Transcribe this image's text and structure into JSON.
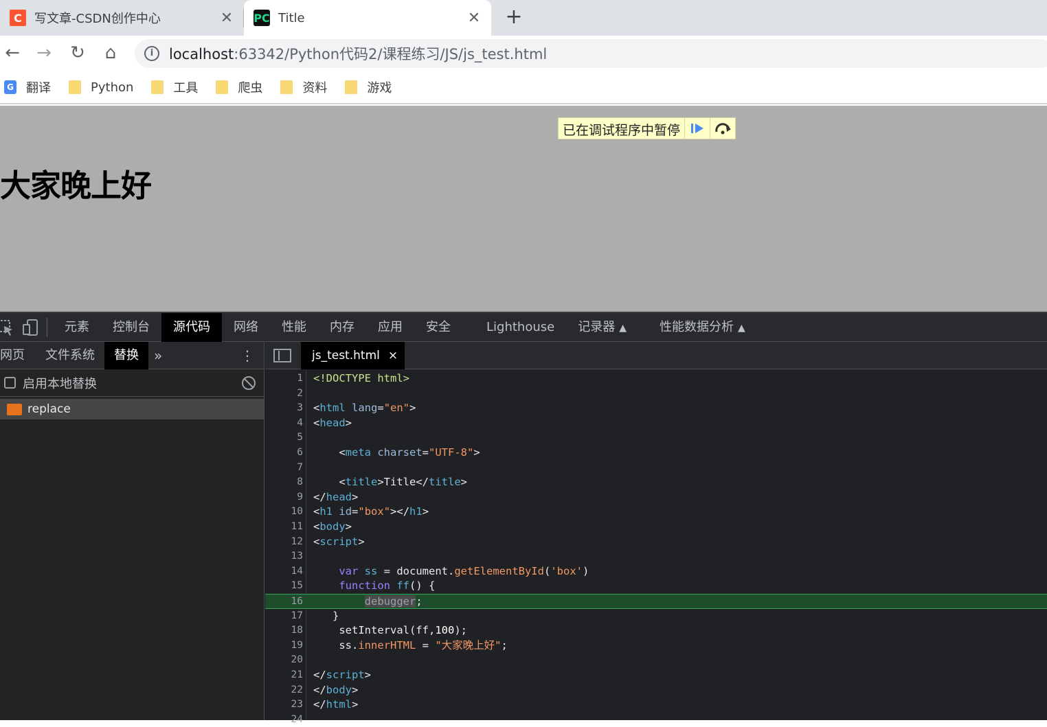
{
  "browser": {
    "tabs": [
      {
        "title": "写文章-CSDN创作中心",
        "favicon": "csdn-icon",
        "active": false
      },
      {
        "title": "Title",
        "favicon": "pycharm-icon",
        "active": true
      }
    ],
    "new_tab_symbol": "+",
    "url_host": "localhost",
    "url_rest": ":63342/Python代码2/课程练习/JS/js_test.html",
    "bookmarks": [
      {
        "label": "翻译",
        "icon": "translate-icon"
      },
      {
        "label": "Python",
        "icon": "folder-icon"
      },
      {
        "label": "工具",
        "icon": "folder-icon"
      },
      {
        "label": "爬虫",
        "icon": "folder-icon"
      },
      {
        "label": "资料",
        "icon": "folder-icon"
      },
      {
        "label": "游戏",
        "icon": "folder-icon"
      }
    ]
  },
  "page": {
    "heading": "大家晚上好",
    "paused_text": "已在调试程序中暂停"
  },
  "devtools": {
    "tabs": [
      "元素",
      "控制台",
      "源代码",
      "网络",
      "性能",
      "内存",
      "应用",
      "安全",
      "Lighthouse",
      "记录器",
      "性能数据分析"
    ],
    "active_tab": "源代码",
    "navigator": {
      "tabs": [
        "网页",
        "文件系统",
        "替换"
      ],
      "active_tab": "替换",
      "more": "»",
      "enable_overrides_label": "启用本地替换",
      "folder": "replace"
    },
    "editor": {
      "file_tab": "js_test.html",
      "close_symbol": "×",
      "current_line": 16
    }
  },
  "colors": {
    "paused_overlay": "#adadad",
    "paused_banner": "#ffffc8",
    "devtools_bg": "#202124",
    "exec_line": "#1e4d2b"
  }
}
